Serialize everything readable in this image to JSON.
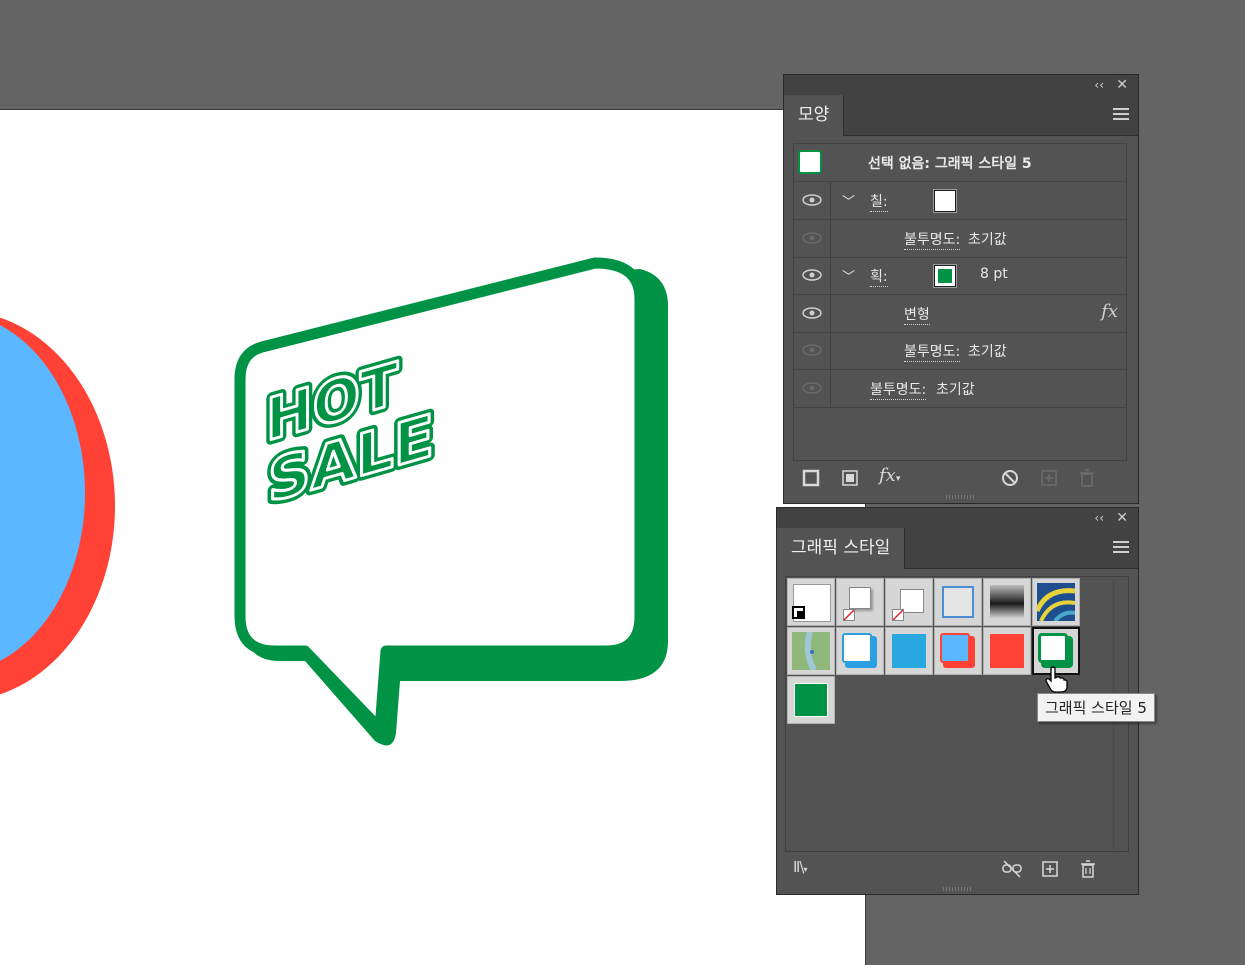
{
  "artwork": {
    "headline_line1": "HOT",
    "headline_line2": "SALE",
    "colors": {
      "green": "#009245",
      "red": "#ff4136",
      "blue": "#5bb7ff",
      "canvas_bg": "#646464",
      "panel_bg": "#535353"
    }
  },
  "appearance_panel": {
    "tab_label": "모양",
    "collapse_icon": "double-chevron-left-icon",
    "close_icon": "close-icon",
    "title": "선택 없음: 그래픽 스타일 5",
    "rows": [
      {
        "label": "칠:",
        "kind": "fill"
      },
      {
        "label": "불투명도:",
        "value": "초기값"
      },
      {
        "label": "획:",
        "kind": "stroke",
        "value": "8 pt"
      },
      {
        "label": "변형",
        "icon": "fx-icon"
      },
      {
        "label": "불투명도:",
        "value": "초기값"
      },
      {
        "label": "불투명도:",
        "value": "초기값"
      }
    ],
    "bottom_icons": [
      "add-stroke-icon",
      "add-fill-icon",
      "add-effect-icon",
      "clear-appearance-icon",
      "duplicate-item-icon",
      "delete-item-icon"
    ]
  },
  "graphic_styles_panel": {
    "tab_label": "그래픽 스타일",
    "selected_index": 11,
    "tooltip": "그래픽 스타일 5",
    "bottom_icons": [
      "graphic-style-libraries-icon",
      "break-link-icon",
      "new-graphic-style-icon",
      "delete-graphic-style-icon"
    ]
  }
}
